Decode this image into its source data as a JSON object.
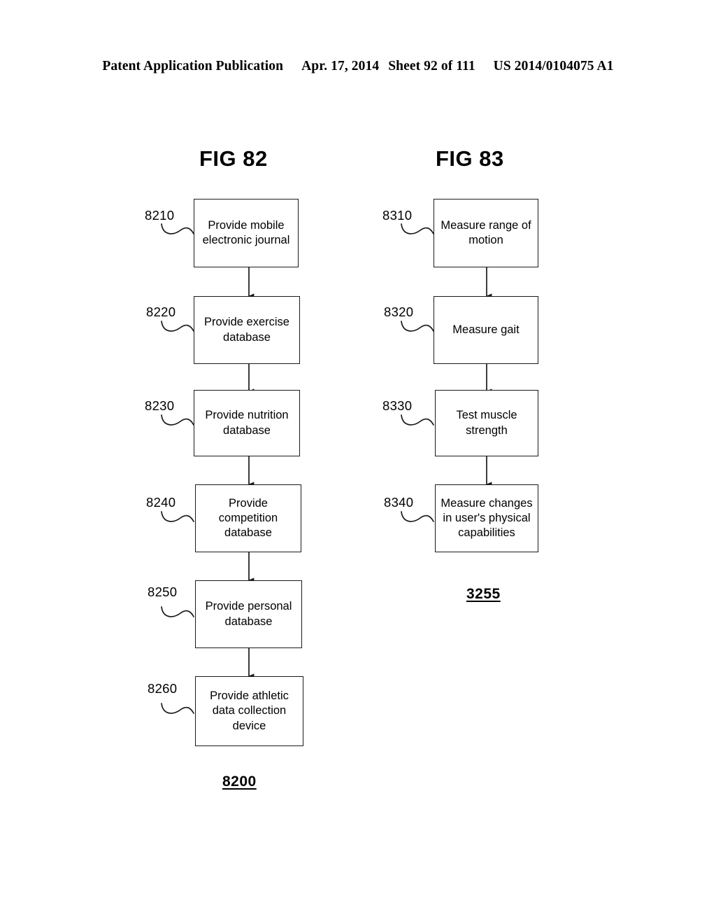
{
  "header": {
    "publication": "Patent Application Publication",
    "date": "Apr. 17, 2014",
    "sheet": "Sheet 92 of 111",
    "patent_number": "US 2014/0104075 A1"
  },
  "figures": [
    {
      "id": "fig82",
      "title": "FIG 82",
      "caption": "8200",
      "steps": [
        {
          "ref": "8210",
          "text": "Provide mobile\nelectronic journal"
        },
        {
          "ref": "8220",
          "text": "Provide exercise\ndatabase"
        },
        {
          "ref": "8230",
          "text": "Provide nutrition\ndatabase"
        },
        {
          "ref": "8240",
          "text": "Provide\ncompetition\ndatabase"
        },
        {
          "ref": "8250",
          "text": "Provide personal\ndatabase"
        },
        {
          "ref": "8260",
          "text": "Provide athletic\ndata collection\ndevice"
        }
      ]
    },
    {
      "id": "fig83",
      "title": "FIG 83",
      "caption": "3255",
      "steps": [
        {
          "ref": "8310",
          "text": "Measure range of\nmotion"
        },
        {
          "ref": "8320",
          "text": "Measure gait"
        },
        {
          "ref": "8330",
          "text": "Test muscle\nstrength"
        },
        {
          "ref": "8340",
          "text": "Measure changes\nin user's physical\ncapabilities"
        }
      ]
    }
  ],
  "colors": {
    "ink": "#000000",
    "paper": "#ffffff",
    "box_border": "#1a1a1a"
  }
}
